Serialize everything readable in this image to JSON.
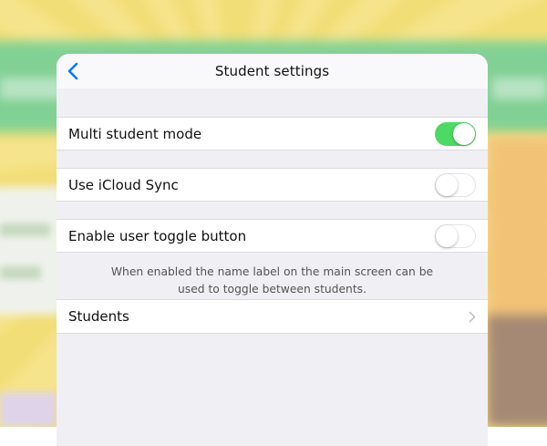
{
  "navbar": {
    "title": "Student settings",
    "back_icon": "chevron-left-icon"
  },
  "settings": {
    "multi_student_mode": {
      "label": "Multi student mode",
      "enabled": true
    },
    "icloud_sync": {
      "label": "Use iCloud Sync",
      "enabled": false
    },
    "user_toggle_button": {
      "label": "Enable user toggle button",
      "enabled": false
    },
    "footnote_line1": "When enabled the name label on the main screen can be",
    "footnote_line2": "used to toggle between students.",
    "students": {
      "label": "Students",
      "icon": "chevron-right-icon"
    }
  },
  "colors": {
    "accent": "#007aff",
    "toggle_on": "#4cd964",
    "background": "#efeff4"
  }
}
